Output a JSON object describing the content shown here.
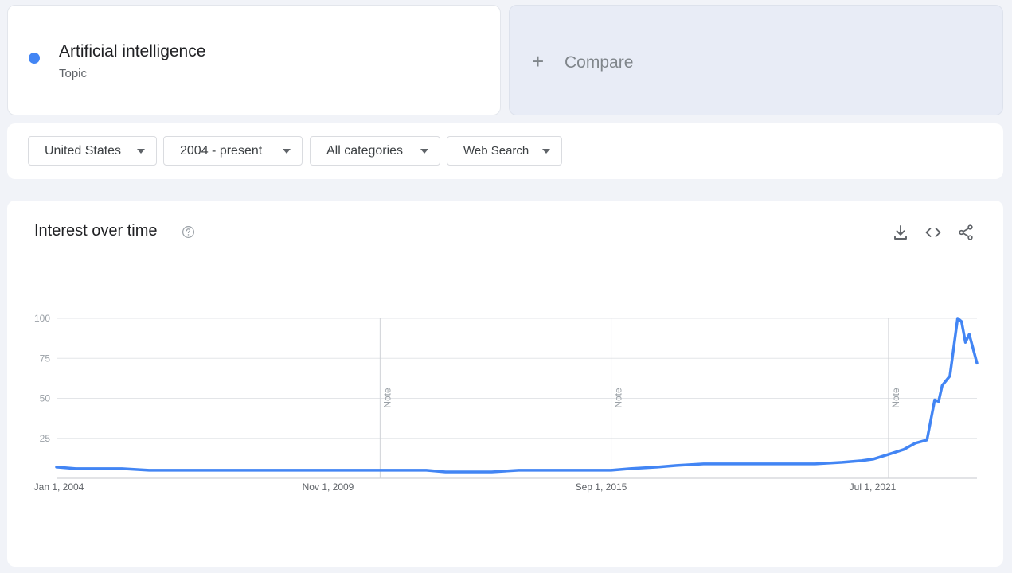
{
  "term": {
    "title": "Artificial intelligence",
    "subtitle": "Topic",
    "color": "#4285f4"
  },
  "compare": {
    "icon": "plus-icon",
    "label": "Compare"
  },
  "filters": {
    "region": "United States",
    "time_range": "2004 - present",
    "category": "All categories",
    "property": "Web Search"
  },
  "chart_section": {
    "title": "Interest over time",
    "help_icon": "help-circle-icon",
    "actions": [
      "download-icon",
      "embed-code-icon",
      "share-icon"
    ]
  },
  "chart_data": {
    "type": "line",
    "y_ticks": [
      25,
      50,
      75,
      100
    ],
    "ylim": [
      0,
      100
    ],
    "x_tick_labels": [
      "Jan 1, 2004",
      "Nov 1, 2009",
      "Sep 1, 2015",
      "Jul 1, 2021"
    ],
    "notes": [
      {
        "label": "Note",
        "date": "2011-01"
      },
      {
        "label": "Note",
        "date": "2016-01"
      },
      {
        "label": "Note",
        "date": "2022-01"
      }
    ],
    "grid": true,
    "legend": "none",
    "color": "#4285f4",
    "series": [
      {
        "points": [
          [
            "2004-01",
            7
          ],
          [
            "2004-06",
            6
          ],
          [
            "2005-01",
            6
          ],
          [
            "2005-06",
            6
          ],
          [
            "2006-01",
            5
          ],
          [
            "2006-06",
            5
          ],
          [
            "2007-01",
            5
          ],
          [
            "2007-06",
            5
          ],
          [
            "2008-01",
            5
          ],
          [
            "2008-06",
            5
          ],
          [
            "2009-01",
            5
          ],
          [
            "2009-06",
            5
          ],
          [
            "2010-01",
            5
          ],
          [
            "2010-06",
            5
          ],
          [
            "2011-01",
            5
          ],
          [
            "2011-06",
            5
          ],
          [
            "2012-01",
            5
          ],
          [
            "2012-06",
            4
          ],
          [
            "2013-01",
            4
          ],
          [
            "2013-06",
            4
          ],
          [
            "2014-01",
            5
          ],
          [
            "2014-06",
            5
          ],
          [
            "2015-01",
            5
          ],
          [
            "2015-06",
            5
          ],
          [
            "2016-01",
            5
          ],
          [
            "2016-06",
            6
          ],
          [
            "2017-01",
            7
          ],
          [
            "2017-06",
            8
          ],
          [
            "2018-01",
            9
          ],
          [
            "2018-06",
            9
          ],
          [
            "2019-01",
            9
          ],
          [
            "2019-06",
            9
          ],
          [
            "2020-01",
            9
          ],
          [
            "2020-06",
            9
          ],
          [
            "2021-01",
            10
          ],
          [
            "2021-06",
            11
          ],
          [
            "2021-09",
            12
          ],
          [
            "2022-01",
            15
          ],
          [
            "2022-05",
            18
          ],
          [
            "2022-08",
            22
          ],
          [
            "2022-11",
            24
          ],
          [
            "2023-01",
            49
          ],
          [
            "2023-02",
            48
          ],
          [
            "2023-03",
            58
          ],
          [
            "2023-05",
            64
          ],
          [
            "2023-07",
            100
          ],
          [
            "2023-08",
            98
          ],
          [
            "2023-09",
            85
          ],
          [
            "2023-10",
            90
          ],
          [
            "2023-12",
            72
          ]
        ]
      }
    ]
  }
}
